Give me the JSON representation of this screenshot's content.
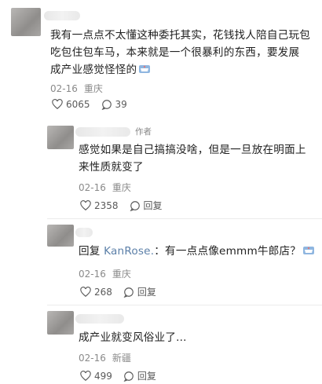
{
  "comments": [
    {
      "text": "我有一点点不太懂这种委托其实，花钱找人陪自己玩包吃包住包车马，本来就是一个很暴利的东西，要发展成产业感觉怪怪的",
      "lines": [
        "我有一点点不太懂这种委托其实，花钱找人陪自己玩包",
        "吃包住包车马，本来就是一个很暴利的东西，要发展",
        "成产业感觉怪怪的"
      ],
      "date": "02-16",
      "location": "重庆",
      "likes": "6065",
      "replies": "39",
      "emoji": "teacup-emoji"
    },
    {
      "badge": "作者",
      "lines": [
        "感觉如果是自己搞搞没啥，但是一旦放在明面上",
        "来性质就变了"
      ],
      "date": "02-16",
      "location": "重庆",
      "likes": "2358",
      "reply_label": "回复"
    },
    {
      "reply_prefix": "回复",
      "mention": "KanRose.",
      "text_after": "：有一点点像emmm牛郎店？",
      "date": "02-16",
      "location": "重庆",
      "likes": "268",
      "reply_label": "回复",
      "emoji": "teacup-emoji"
    },
    {
      "text": "成产业就变风俗业了...",
      "date": "02-16",
      "location": "新疆",
      "likes": "499",
      "reply_label": "回复"
    }
  ],
  "colors": {
    "text": "#222222",
    "meta": "#8a8a8a",
    "mention": "#5b7fa8"
  }
}
